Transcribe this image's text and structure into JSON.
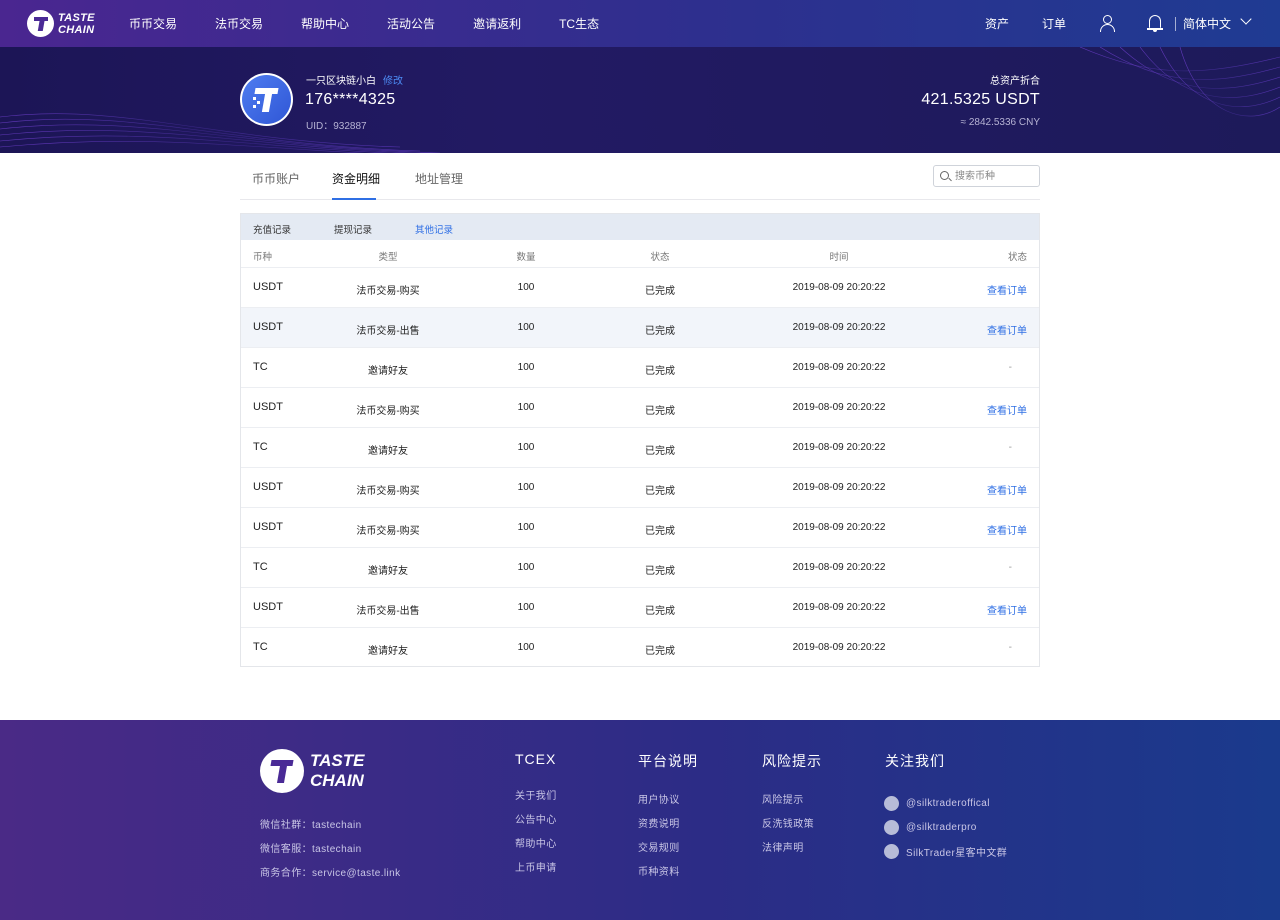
{
  "nav": {
    "logo_line1": "TASTE",
    "logo_line2": "CHAIN",
    "items": [
      "币币交易",
      "法币交易",
      "帮助中心",
      "活动公告",
      "邀请返利",
      "TC生态"
    ],
    "assets": "资产",
    "orders": "订单",
    "language": "简体中文"
  },
  "profile": {
    "nickname": "一只区块链小白",
    "edit": "修改",
    "phone": "176****4325",
    "uid": "UID：932887",
    "total_label": "总资产折合",
    "total_usdt": "421.5325 USDT",
    "total_cny": "≈ 2842.5336 CNY"
  },
  "tabs": [
    "币币账户",
    "资金明细",
    "地址管理"
  ],
  "active_tab": "资金明细",
  "search": {
    "placeholder": "搜索币种"
  },
  "subtabs": [
    "充值记录",
    "提现记录",
    "其他记录"
  ],
  "table": {
    "headers": [
      "币种",
      "类型",
      "数量",
      "状态",
      "时间",
      "状态"
    ],
    "rows": [
      {
        "coin": "USDT",
        "type": "法币交易-购买",
        "amount": "100",
        "status": "已完成",
        "time": "2019-08-09 20:20:22",
        "action": "查看订单"
      },
      {
        "coin": "USDT",
        "type": "法币交易-出售",
        "amount": "100",
        "status": "已完成",
        "time": "2019-08-09 20:20:22",
        "action": "查看订单"
      },
      {
        "coin": "TC",
        "type": "邀请好友",
        "amount": "100",
        "status": "已完成",
        "time": "2019-08-09 20:20:22",
        "action": "-"
      },
      {
        "coin": "USDT",
        "type": "法币交易-购买",
        "amount": "100",
        "status": "已完成",
        "time": "2019-08-09 20:20:22",
        "action": "查看订单"
      },
      {
        "coin": "TC",
        "type": "邀请好友",
        "amount": "100",
        "status": "已完成",
        "time": "2019-08-09 20:20:22",
        "action": "-"
      },
      {
        "coin": "USDT",
        "type": "法币交易-购买",
        "amount": "100",
        "status": "已完成",
        "time": "2019-08-09 20:20:22",
        "action": "查看订单"
      },
      {
        "coin": "USDT",
        "type": "法币交易-购买",
        "amount": "100",
        "status": "已完成",
        "time": "2019-08-09 20:20:22",
        "action": "查看订单"
      },
      {
        "coin": "TC",
        "type": "邀请好友",
        "amount": "100",
        "status": "已完成",
        "time": "2019-08-09 20:20:22",
        "action": "-"
      },
      {
        "coin": "USDT",
        "type": "法币交易-出售",
        "amount": "100",
        "status": "已完成",
        "time": "2019-08-09 20:20:22",
        "action": "查看订单"
      },
      {
        "coin": "TC",
        "type": "邀请好友",
        "amount": "100",
        "status": "已完成",
        "time": "2019-08-09 20:20:22",
        "action": "-"
      }
    ]
  },
  "footer": {
    "logo_line1": "TASTE",
    "logo_line2": "CHAIN",
    "contacts": [
      "微信社群：tastechain",
      "微信客服：tastechain",
      "商务合作：service@taste.link"
    ],
    "columns": [
      {
        "title": "TCEX",
        "links": [
          "关于我们",
          "公告中心",
          "帮助中心",
          "上币申请"
        ]
      },
      {
        "title": "平台说明",
        "links": [
          "用户协议",
          "资费说明",
          "交易规则",
          "币种资料"
        ]
      },
      {
        "title": "风险提示",
        "links": [
          "风险提示",
          "反洗钱政策",
          "法律声明"
        ]
      },
      {
        "title": "关注我们",
        "links": [
          "@silktraderoffical",
          "@silktraderpro",
          "SilkTrader星客中文群"
        ]
      }
    ]
  },
  "colors": {
    "accent": "#2f6fe4",
    "nav_start": "#4a2690",
    "nav_end": "#1f3b92",
    "banner": "#1c1556"
  }
}
